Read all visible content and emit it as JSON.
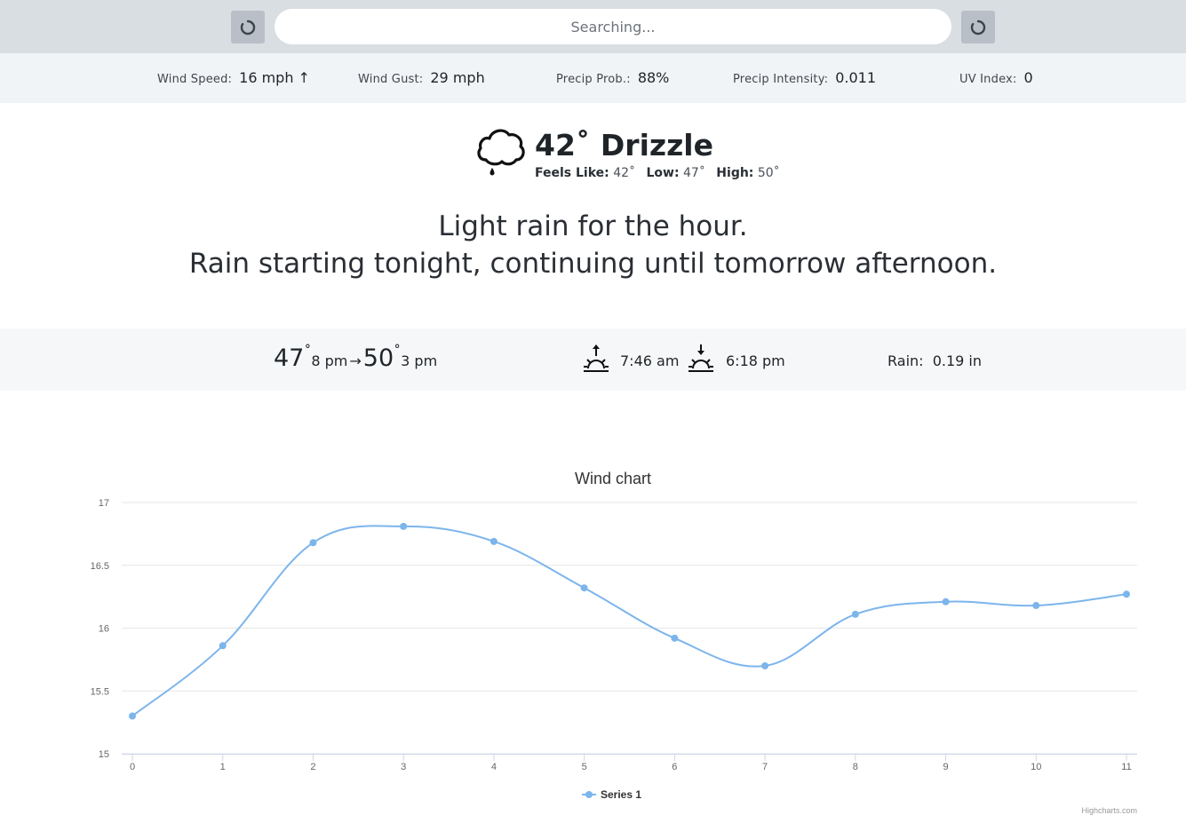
{
  "search": {
    "placeholder": "Searching..."
  },
  "toolbar": {
    "left_icon": "refresh-icon",
    "right_icon": "refresh-icon"
  },
  "stats": [
    {
      "label": "Wind Speed:",
      "value": "16 mph ↑"
    },
    {
      "label": "Wind Gust:",
      "value": "29 mph"
    },
    {
      "label": "Precip Prob.:",
      "value": "88%"
    },
    {
      "label": "Precip Intensity:",
      "value": "0.011"
    },
    {
      "label": "UV Index:",
      "value": "0"
    }
  ],
  "current": {
    "icon": "drizzle-cloud-icon",
    "headline": "42˚ Drizzle",
    "feels_label": "Feels Like:",
    "feels_value": "42˚",
    "low_label": "Low:",
    "low_value": "47˚",
    "high_label": "High:",
    "high_value": "50˚"
  },
  "summary": {
    "line1": "Light rain for the hour.",
    "line2": "Rain starting tonight, continuing until tomorrow afternoon."
  },
  "daily": {
    "temp_low": "47",
    "temp_low_deg": "˚",
    "temp_low_time": "8 pm",
    "arrow": "→",
    "temp_high": "50",
    "temp_high_deg": "˚",
    "temp_high_time": "3 pm",
    "sunrise_icon": "sunrise-icon",
    "sunrise": "7:46 am",
    "sunset_icon": "sunset-icon",
    "sunset": "6:18 pm",
    "rain_label": "Rain:",
    "rain_value": "0.19 in"
  },
  "colors": {
    "series": "#7cb5ec",
    "topbar": "#d9dee3"
  },
  "chart_data": {
    "type": "line",
    "title": "Wind chart",
    "x": [
      0,
      1,
      2,
      3,
      4,
      5,
      6,
      7,
      8,
      9,
      10,
      11
    ],
    "series": [
      {
        "name": "Series 1",
        "values": [
          15.3,
          15.86,
          16.68,
          16.81,
          16.69,
          16.32,
          15.92,
          15.7,
          16.11,
          16.21,
          16.18,
          16.27
        ]
      }
    ],
    "yticks": [
      15,
      15.5,
      16,
      16.5,
      17
    ],
    "ylim": [
      15,
      17
    ],
    "xlim": [
      0,
      11
    ],
    "grid": true,
    "legend": "bottom-center",
    "credit": "Highcharts.com"
  }
}
